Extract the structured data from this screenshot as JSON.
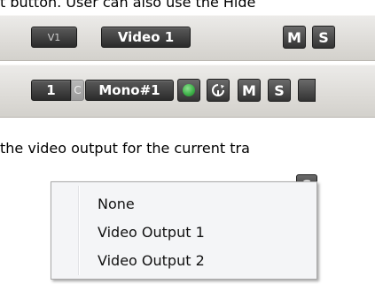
{
  "intro_text_fragment": "t button. User can also use the Hide",
  "video_track": {
    "number_label": "V1",
    "name": "Video 1",
    "mute_label": "M",
    "solo_label": "S"
  },
  "audio_track": {
    "number_label": "1",
    "channel_label": "C",
    "name": "Mono#1",
    "mute_label": "M",
    "solo_label": "S"
  },
  "caption_text_fragment": "the video output for the current tra",
  "dropdown": {
    "partial_label_behind": "S",
    "items": [
      {
        "label": "None"
      },
      {
        "label": "Video Output 1"
      },
      {
        "label": "Video Output 2"
      }
    ]
  },
  "colors": {
    "record_indicator": "#3fb24a",
    "button_dark": "#333333",
    "track_background": "#dddbd7"
  }
}
